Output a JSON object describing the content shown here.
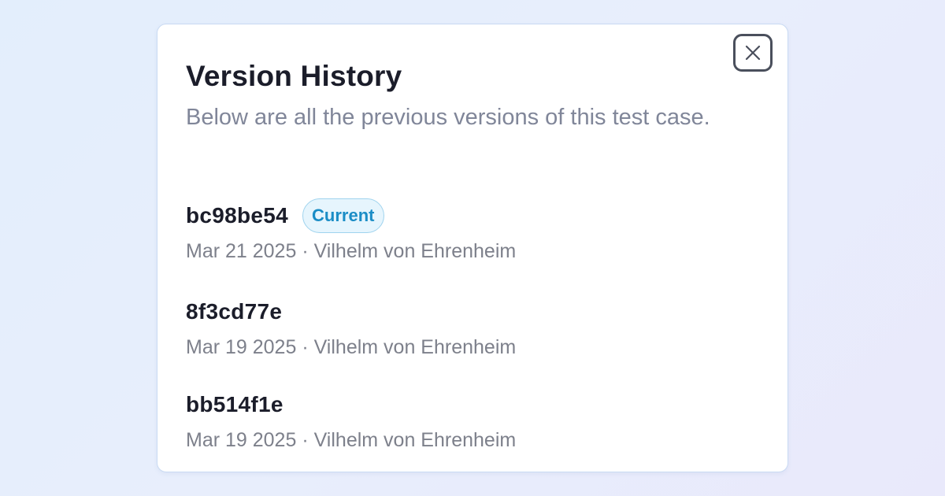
{
  "dialog": {
    "title": "Version History",
    "subtitle": "Below are all the previous versions of this test case.",
    "close_icon": "close-icon"
  },
  "versions": [
    {
      "hash": "bc98be54",
      "badge": "Current",
      "meta": "Mar 21 2025 · Vilhelm von Ehrenheim"
    },
    {
      "hash": "8f3cd77e",
      "badge": null,
      "meta": "Mar 19 2025 · Vilhelm von Ehrenheim"
    },
    {
      "hash": "bb514f1e",
      "badge": null,
      "meta": "Mar 19 2025 · Vilhelm von Ehrenheim"
    }
  ],
  "colors": {
    "badge_text": "#1b8dc6",
    "badge_bg": "#e6f5fd",
    "badge_border": "#9fd3ee",
    "title": "#1b1d2a",
    "muted": "#808699"
  }
}
